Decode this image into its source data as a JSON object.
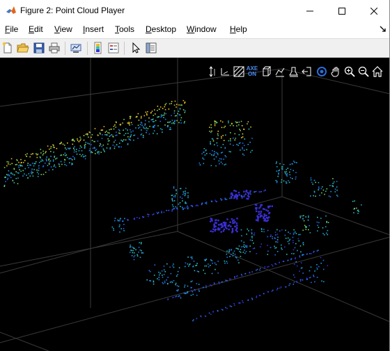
{
  "window": {
    "title": "Figure 2: Point Cloud Player",
    "controls": [
      "minimize",
      "maximize",
      "close"
    ]
  },
  "menu": {
    "items": [
      "File",
      "Edit",
      "View",
      "Insert",
      "Tools",
      "Desktop",
      "Window",
      "Help"
    ]
  },
  "toolbar": {
    "buttons": [
      "new-figure-icon",
      "open-folder-icon",
      "save-icon",
      "print-icon",
      "link-plot-icon",
      "colorbar-icon",
      "legend-icon",
      "pointer-icon",
      "property-inspector-icon"
    ]
  },
  "axes_toolbar": {
    "axes_toggle_line1": "AXE",
    "axes_toggle_line2": "ON",
    "tools": [
      "vertical-axis-icon",
      "ground-plane-icon",
      "background-color-icon",
      "axes-toggle-icon",
      "view-icon",
      "color-source-icon",
      "clip-icon",
      "restore-view-icon",
      "rotate-icon",
      "pan-icon",
      "zoom-in-icon",
      "zoom-out-icon",
      "home-icon"
    ]
  },
  "colors": {
    "figure_background": "#000000",
    "grid": "#3a3a3a",
    "colormap": [
      "#3a2fd6",
      "#2470e8",
      "#1aa5d8",
      "#2ec4b0",
      "#7fd05a",
      "#e0bc2a",
      "#f0d020"
    ],
    "toolbar_background": "#f0f0f0",
    "active_tool": "#2a6ed8"
  }
}
